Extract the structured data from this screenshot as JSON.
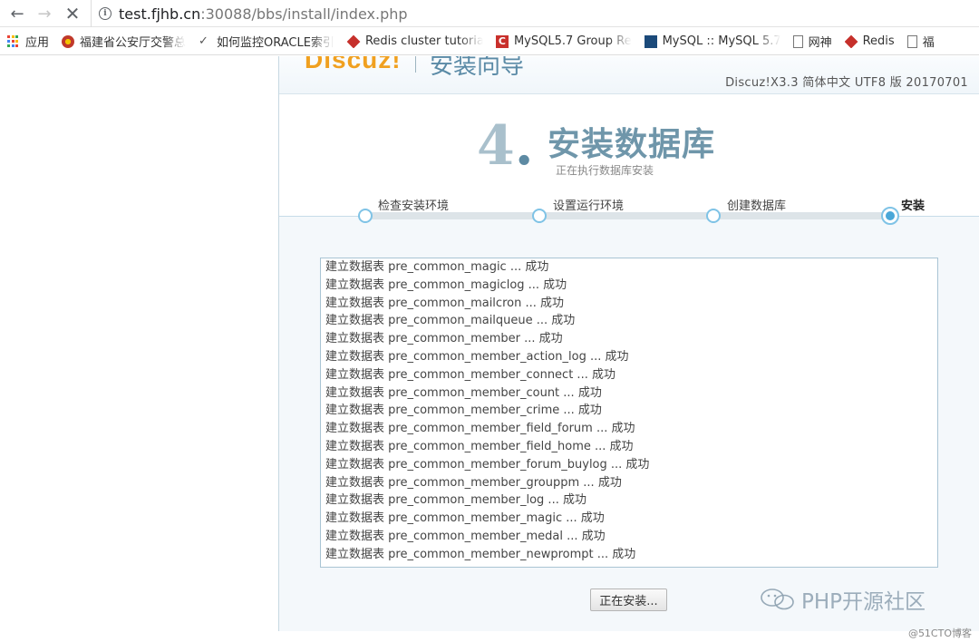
{
  "browser": {
    "url_host": "test.fjhb.cn",
    "url_path": ":30088/bbs/install/index.php",
    "bookmarks": [
      {
        "label": "应用",
        "icon": "apps-grid-icon"
      },
      {
        "label": "福建省公安厅交警总",
        "icon": "police-badge-icon"
      },
      {
        "label": "如何监控ORACLE索引",
        "icon": "bookmark-icon"
      },
      {
        "label": "Redis cluster tutoria",
        "icon": "redis-icon"
      },
      {
        "label": "MySQL5.7 Group Re",
        "icon": "csdn-icon"
      },
      {
        "label": "MySQL :: MySQL 5.7",
        "icon": "mysql-icon"
      },
      {
        "label": "网神",
        "icon": "page-icon"
      },
      {
        "label": "Redis",
        "icon": "redis-icon"
      },
      {
        "label": "福",
        "icon": "page-icon"
      }
    ]
  },
  "installer": {
    "logo": "Discuz!",
    "logo_sub": "安装向导",
    "version": "Discuz!X3.3 简体中文 UTF8 版 20170701",
    "step_number": "4",
    "step_dot": ".",
    "step_title": "安装数据库",
    "step_subtitle": "正在执行数据库安装",
    "steps": [
      "检查安装环境",
      "设置运行环境",
      "创建数据库",
      "安装"
    ],
    "log_lines": [
      "建立数据表 pre_common_magic ... 成功",
      "建立数据表 pre_common_magiclog ... 成功",
      "建立数据表 pre_common_mailcron ... 成功",
      "建立数据表 pre_common_mailqueue ... 成功",
      "建立数据表 pre_common_member ... 成功",
      "建立数据表 pre_common_member_action_log ... 成功",
      "建立数据表 pre_common_member_connect ... 成功",
      "建立数据表 pre_common_member_count ... 成功",
      "建立数据表 pre_common_member_crime ... 成功",
      "建立数据表 pre_common_member_field_forum ... 成功",
      "建立数据表 pre_common_member_field_home ... 成功",
      "建立数据表 pre_common_member_forum_buylog ... 成功",
      "建立数据表 pre_common_member_grouppm ... 成功",
      "建立数据表 pre_common_member_log ... 成功",
      "建立数据表 pre_common_member_magic ... 成功",
      "建立数据表 pre_common_member_medal ... 成功",
      "建立数据表 pre_common_member_newprompt ... 成功"
    ],
    "button_label": "正在安装..."
  },
  "watermark": "PHP开源社区",
  "credit": "@51CTO博客",
  "colors": {
    "accent": "#4aa7d8",
    "title": "#6f96aa",
    "logo": "#f0a020"
  }
}
